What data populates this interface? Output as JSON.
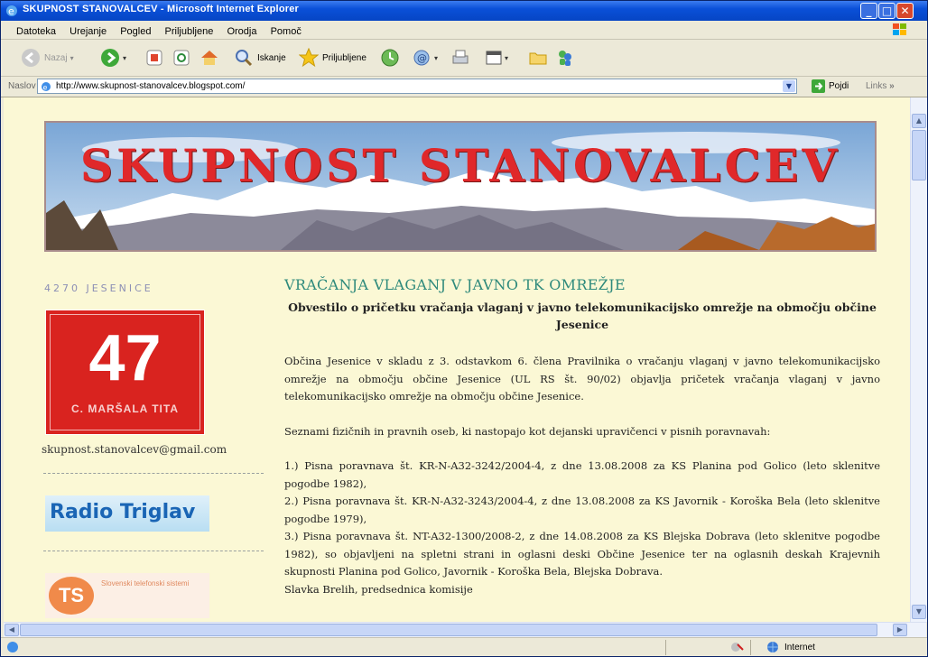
{
  "window": {
    "title": "SKUPNOST STANOVALCEV - Microsoft Internet Explorer"
  },
  "menu": [
    "Datoteka",
    "Urejanje",
    "Pogled",
    "Priljubljene",
    "Orodja",
    "Pomoč"
  ],
  "toolbar": {
    "back_label": "Nazaj",
    "search_label": "Iskanje",
    "favorites_label": "Priljubljene"
  },
  "address": {
    "label": "Naslov",
    "url": "http://www.skupnost-stanovalcev.blogspot.com/",
    "go_label": "Pojdi",
    "links_label": "Links"
  },
  "status": {
    "zone": "Internet"
  },
  "colors": {
    "background": "#fbf8d5",
    "post_title": "#2f8a7c",
    "plate": "#d9231f"
  },
  "page": {
    "banner_title": "SKUPNOST STANOVALCEV",
    "sidebar": {
      "city": "4270 JESENICE",
      "plate_number": "47",
      "plate_street": "C. MARŠALA TITA",
      "email": "skupnost.stanovalcev@gmail.com",
      "radio": "Radio Triglav",
      "ts_logo": "TS",
      "ts_text": "Slovenski telefonski sistemi"
    },
    "post": {
      "title": "VRAČANJA VLAGANJ V JAVNO TK OMREŽJE",
      "subtitle": "Obvestilo o pričetku vračanja vlaganj v javno telekomunikacijsko omrežje na območju občine Jesenice",
      "p1": "Občina Jesenice v skladu z 3. odstavkom 6. člena Pravilnika o vračanju vlaganj v javno telekomunikacijsko omrežje na območju občine Jesenice (UL RS št. 90/02) objavlja pričetek vračanja vlaganj v javno telekomunikacijsko omrežje na območju občine Jesenice.",
      "p2": "Seznami fizičnih in pravnih oseb, ki nastopajo kot dejanski upravičenci v pisnih poravnavah:",
      "p3": "1.) Pisna poravnava št. KR-N-A32-3242/2004-4, z dne 13.08.2008 za KS Planina pod Golico (leto sklenitve pogodbe 1982),",
      "p4": "2.) Pisna poravnava št. KR-N-A32-3243/2004-4, z dne 13.08.2008 za KS Javornik - Koroška Bela (leto sklenitve pogodbe 1979),",
      "p5": "3.) Pisna poravnava št. NT-A32-1300/2008-2, z dne 14.08.2008 za KS Blejska Dobrava (leto sklenitve pogodbe 1982), so objavljeni na spletni strani in oglasni deski Občine Jesenice ter na oglasnih deskah Krajevnih skupnosti Planina pod Golico, Javornik - Koroška Bela, Blejska Dobrava.",
      "p6": "Slavka Brelih, predsednica komisije"
    }
  }
}
